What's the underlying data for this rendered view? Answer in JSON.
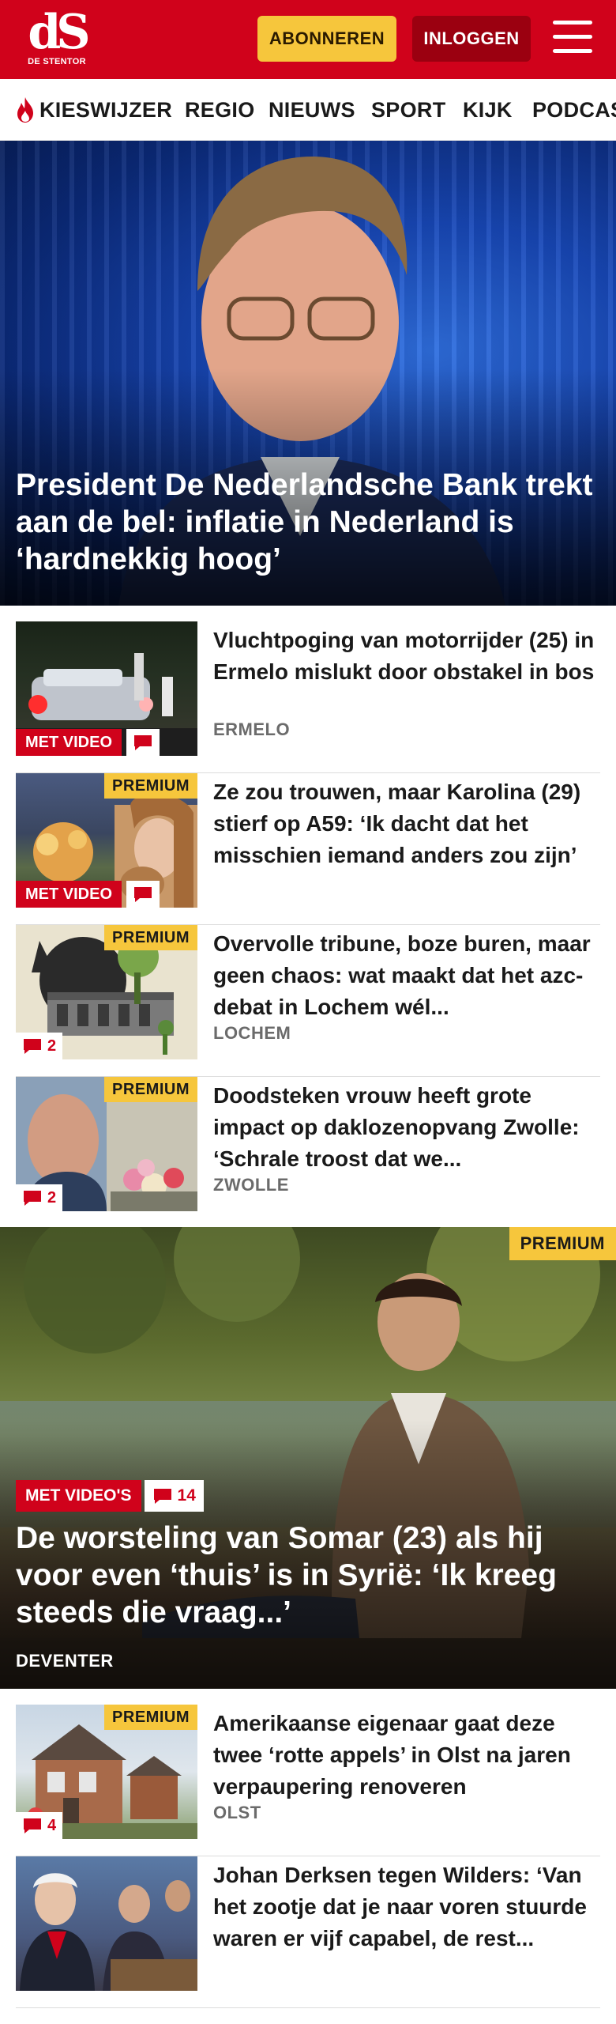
{
  "header": {
    "logo_mark": "dS",
    "logo_sub": "DE STENTOR",
    "subscribe_label": "ABONNEREN",
    "login_label": "INLOGGEN",
    "menu_icon": "hamburger-menu-icon"
  },
  "nav": {
    "items": [
      {
        "label": "KIESWIJZER",
        "icon": "flame-icon"
      },
      {
        "label": "REGIO"
      },
      {
        "label": "NIEUWS"
      },
      {
        "label": "SPORT"
      },
      {
        "label": "KIJK"
      },
      {
        "label": "PODCAS"
      }
    ]
  },
  "hero": {
    "title": "President De Nederlandsche Bank trekt aan de bel: inflatie in Nederland is ‘hardnekkig hoog’"
  },
  "articles": [
    {
      "title": "Vluchtpoging van motorrijder (25) in Ermelo mislukt door obstakel in bos",
      "location": "ERMELO",
      "video_label": "MET VIDEO",
      "comments": "",
      "premium": ""
    },
    {
      "title": "Ze zou trouwen, maar Karolina (29) stierf op A59: ‘Ik dacht dat het misschien iemand anders zou zijn’",
      "location": "",
      "video_label": "MET VIDEO",
      "comments": "",
      "premium": "PREMIUM"
    },
    {
      "title": "Overvolle tribune, boze buren, maar geen chaos: wat maakt dat het azc-debat in Lochem wél...",
      "location": "LOCHEM",
      "video_label": "",
      "comments": "2",
      "premium": "PREMIUM"
    },
    {
      "title": "Doodsteken vrouw heeft grote impact op daklozenopvang Zwolle: ‘Schrale troost dat we...",
      "location": "ZWOLLE",
      "video_label": "",
      "comments": "2",
      "premium": "PREMIUM"
    }
  ],
  "feature": {
    "premium": "PREMIUM",
    "video_label": "MET VIDEO'S",
    "comments": "14",
    "title": "De worsteling van Somar (23) als hij voor even ‘thuis’ is in Syrië: ‘Ik kreeg steeds die vraag...’",
    "location": "DEVENTER"
  },
  "articles_bottom": [
    {
      "title": "Amerikaanse eigenaar gaat deze twee ‘rotte appels’ in Olst na jaren verpaupering renoveren",
      "location": "OLST",
      "comments": "4",
      "premium": "PREMIUM"
    },
    {
      "title": "Johan Derksen tegen Wilders: ‘Van het zootje dat je naar voren stuurde waren er vijf capabel, de rest...",
      "location": "",
      "comments": "",
      "premium": ""
    }
  ],
  "colors": {
    "brand_red": "#d0021b",
    "premium_yellow": "#f6c63c",
    "login_dark_red": "#9b0010"
  }
}
